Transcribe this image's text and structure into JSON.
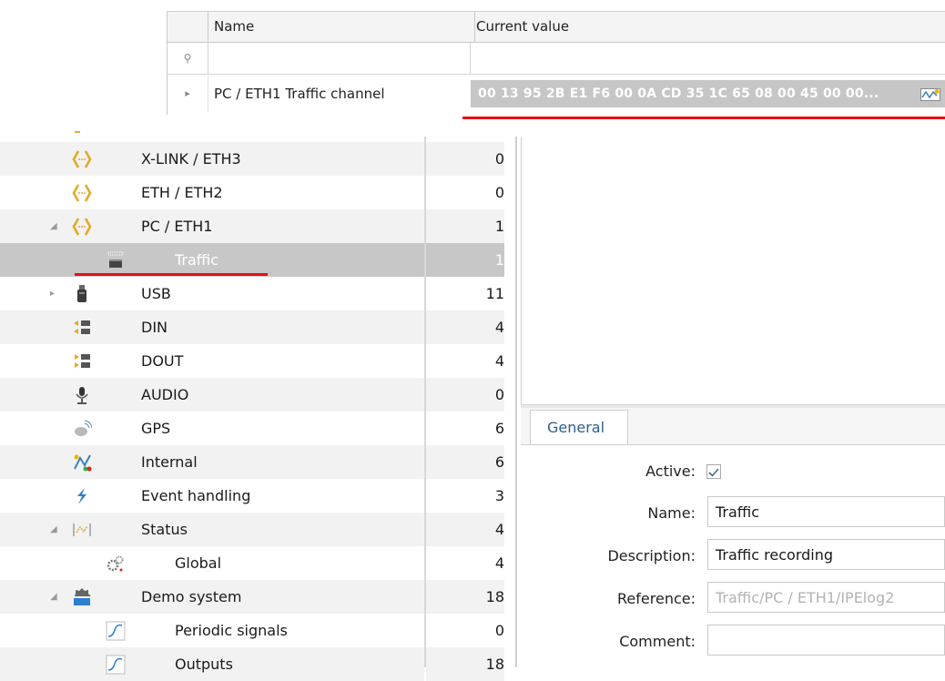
{
  "grid": {
    "header": {
      "name": "Name",
      "value": "Current value"
    },
    "filter_icon": "⚲",
    "row": {
      "expander": "▸",
      "name": "PC / ETH1 Traffic channel",
      "value": "00 13 95 2B E1 F6 00 0A CD 35 1C 65 08 00 45 00 00...",
      "icon": "waveform-editor-icon"
    }
  },
  "tree": {
    "items": [
      {
        "label": "X-LINK / ETH3",
        "count": "0",
        "icon": "network-port-icon",
        "level": 0,
        "expander": ""
      },
      {
        "label": "ETH / ETH2",
        "count": "0",
        "icon": "network-port-icon",
        "level": 0,
        "expander": ""
      },
      {
        "label": "PC / ETH1",
        "count": "1",
        "icon": "network-port-icon",
        "level": 0,
        "expander": "◢"
      },
      {
        "label": "Traffic",
        "count": "1",
        "icon": "traffic-recorder-icon",
        "level": 1,
        "expander": "",
        "selected": true
      },
      {
        "label": "USB",
        "count": "11",
        "icon": "usb-icon",
        "level": 0,
        "expander": "▸"
      },
      {
        "label": "DIN",
        "count": "4",
        "icon": "digital-input-icon",
        "level": 0,
        "expander": ""
      },
      {
        "label": "DOUT",
        "count": "4",
        "icon": "digital-output-icon",
        "level": 0,
        "expander": ""
      },
      {
        "label": "AUDIO",
        "count": "0",
        "icon": "microphone-icon",
        "level": 0,
        "expander": ""
      },
      {
        "label": "GPS",
        "count": "6",
        "icon": "satellite-icon",
        "level": 0,
        "expander": ""
      },
      {
        "label": "Internal",
        "count": "6",
        "icon": "internal-signals-icon",
        "level": 0,
        "expander": ""
      },
      {
        "label": "Event handling",
        "count": "3",
        "icon": "lightning-icon",
        "level": 0,
        "expander": ""
      },
      {
        "label": "Status",
        "count": "4",
        "icon": "status-icon",
        "level": 0,
        "expander": "◢"
      },
      {
        "label": "Global",
        "count": "4",
        "icon": "gears-icon",
        "level": 1,
        "expander": ""
      },
      {
        "label": "Demo system",
        "count": "18",
        "icon": "demo-system-icon",
        "level": 0,
        "expander": "◢"
      },
      {
        "label": "Periodic signals",
        "count": "0",
        "icon": "signal-curve-icon",
        "level": 1,
        "expander": ""
      },
      {
        "label": "Outputs",
        "count": "18",
        "icon": "signal-curve-icon",
        "level": 1,
        "expander": ""
      }
    ]
  },
  "props": {
    "tab": "General",
    "active_label": "Active:",
    "active_checked": true,
    "name_label": "Name:",
    "name_value": "Traffic",
    "description_label": "Description:",
    "description_value": "Traffic recording",
    "reference_label": "Reference:",
    "reference_value": "Traffic/PC / ETH1/IPElog2",
    "comment_label": "Comment:",
    "comment_value": ""
  },
  "colors": {
    "highlight_red": "#e81010",
    "selection_gray": "#c7c7c7",
    "tab_text": "#2b5f8f"
  }
}
